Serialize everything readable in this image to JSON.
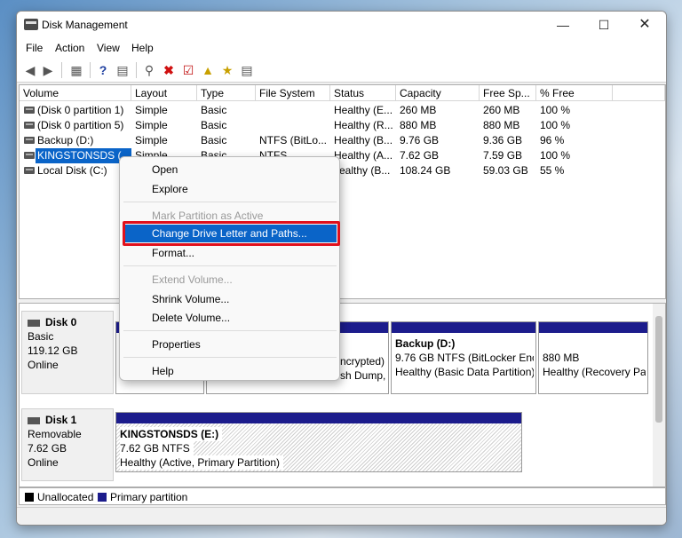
{
  "window": {
    "title": "Disk Management"
  },
  "menu": [
    "File",
    "Action",
    "View",
    "Help"
  ],
  "volume_table": {
    "columns": [
      "Volume",
      "Layout",
      "Type",
      "File System",
      "Status",
      "Capacity",
      "Free Sp...",
      "% Free"
    ],
    "rows": [
      [
        "(Disk 0 partition 1)",
        "Simple",
        "Basic",
        "",
        "Healthy (E...",
        "260 MB",
        "260 MB",
        "100 %"
      ],
      [
        "(Disk 0 partition 5)",
        "Simple",
        "Basic",
        "",
        "Healthy (R...",
        "880 MB",
        "880 MB",
        "100 %"
      ],
      [
        "Backup (D:)",
        "Simple",
        "Basic",
        "NTFS (BitLo...",
        "Healthy (B...",
        "9.76 GB",
        "9.36 GB",
        "96 %"
      ],
      [
        "KINGSTONSDS (...",
        "Simple",
        "Basic",
        "NTFS",
        "Healthy (A...",
        "7.62 GB",
        "7.59 GB",
        "100 %"
      ],
      [
        "Local Disk (C:)",
        "",
        "",
        "",
        "ealthy (B...",
        "108.24 GB",
        "59.03 GB",
        "55 %"
      ]
    ]
  },
  "context_menu": {
    "items": {
      "open": "Open",
      "explore": "Explore",
      "mark_active": "Mark Partition as Active",
      "change_letter": "Change Drive Letter and Paths...",
      "format": "Format...",
      "extend": "Extend Volume...",
      "shrink": "Shrink Volume...",
      "delete": "Delete Volume...",
      "properties": "Properties",
      "help": "Help"
    }
  },
  "disks": [
    {
      "name": "Disk 0",
      "type": "Basic",
      "size": "119.12 GB",
      "status": "Online"
    },
    {
      "name": "Disk 1",
      "type": "Removable",
      "size": "7.62 GB",
      "status": "Online"
    }
  ],
  "disk0_partitions": {
    "c_partial": {
      "line1": "ncrypted)",
      "line2": "sh Dump,"
    },
    "backup": {
      "title": "Backup  (D:)",
      "line1": "9.76 GB NTFS (BitLocker Encr",
      "line2": "Healthy (Basic Data Partition)"
    },
    "recovery": {
      "line1": "880 MB",
      "line2": "Healthy (Recovery Pa"
    }
  },
  "disk1_partition": {
    "title": "KINGSTONSDS  (E:)",
    "line1": "7.62 GB NTFS",
    "line2": "Healthy (Active, Primary Partition)"
  },
  "legend": {
    "unallocated": "Unallocated",
    "primary": "Primary partition"
  },
  "colors": {
    "primary_bar": "#1c1c8c",
    "selection": "#0a64c8",
    "highlight_box": "#e0101c"
  }
}
